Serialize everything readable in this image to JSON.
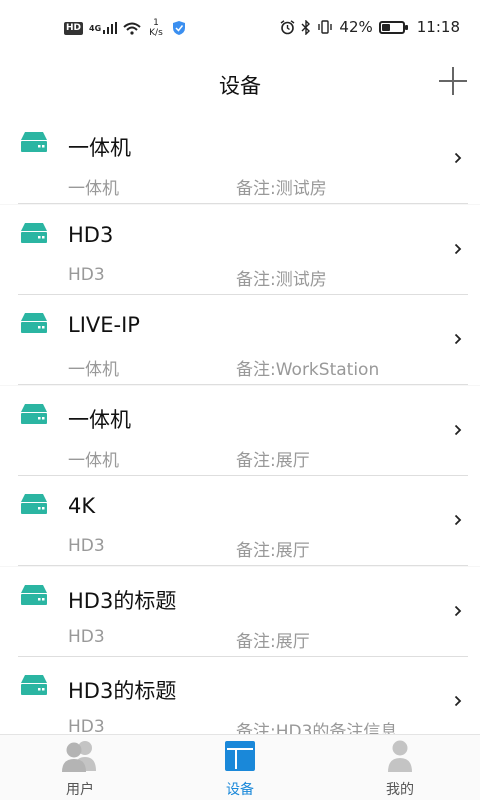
{
  "status_bar": {
    "hd": "HD",
    "network": "4G",
    "speed_value": "1",
    "speed_unit": "K/s",
    "battery": "42%",
    "battery_level": 0.42,
    "time": "11:18"
  },
  "header": {
    "title": "设备",
    "add_icon": "plus-icon"
  },
  "colors": {
    "device_icon": "#2bb5a2",
    "active_tab": "#1a88d9",
    "inactive_tab": "#bdbdbd"
  },
  "devices": [
    {
      "name": "一体机",
      "type": "一体机",
      "note": "备注:测试房"
    },
    {
      "name": "HD3",
      "type": "HD3",
      "note": "备注:测试房"
    },
    {
      "name": "LIVE-IP",
      "type": "一体机",
      "note": "备注:WorkStation"
    },
    {
      "name": "一体机",
      "type": "一体机",
      "note": "备注:展厅"
    },
    {
      "name": "4K",
      "type": "HD3",
      "note": "备注:展厅"
    },
    {
      "name": "HD3的标题",
      "type": "HD3",
      "note": "备注:展厅"
    },
    {
      "name": "HD3的标题",
      "type": "HD3",
      "note": "备注:HD3的备注信息"
    }
  ],
  "tabs": [
    {
      "label": "用户",
      "icon": "users-icon",
      "active": false
    },
    {
      "label": "设备",
      "icon": "device-tab-icon",
      "active": true
    },
    {
      "label": "我的",
      "icon": "profile-icon",
      "active": false
    }
  ]
}
